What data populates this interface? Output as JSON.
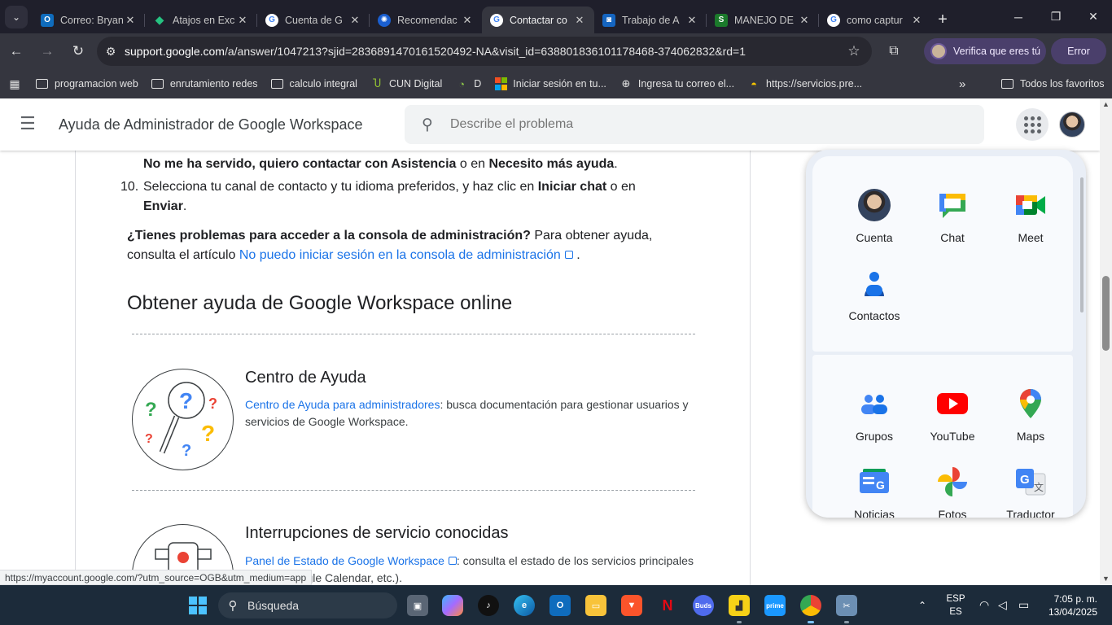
{
  "browser": {
    "tabs": [
      {
        "title": "Correo: Bryan",
        "fav": "O",
        "color": "#0f6cbd"
      },
      {
        "title": "Atajos en Exc",
        "fav": "◆",
        "color": "#1f1f2b"
      },
      {
        "title": "Cuenta de G",
        "fav": "G",
        "color": "#ffffff"
      },
      {
        "title": "Recomendac",
        "fav": "✺",
        "color": "#1a5fd0"
      },
      {
        "title": "Contactar co",
        "fav": "G",
        "color": "#ffffff"
      },
      {
        "title": "Trabajo de A",
        "fav": "◙",
        "color": "#1565c0"
      },
      {
        "title": "MANEJO DE",
        "fav": "S",
        "color": "#1b7a2b"
      },
      {
        "title": "como captur",
        "fav": "G",
        "color": "#ffffff"
      }
    ],
    "url_host": "support.google.com",
    "url_rest": "/a/answer/1047213?sjid=2836891470161520492-NA&visit_id=638801836101178468-374062832&rd=1",
    "verify_label": "Verifica que eres tú",
    "error_label": "Error",
    "bookmarks": [
      {
        "label": "programacion web",
        "type": "folder"
      },
      {
        "label": "enrutamiento redes",
        "type": "folder"
      },
      {
        "label": "calculo integral",
        "type": "folder"
      },
      {
        "label": "CUN Digital",
        "type": "icon",
        "icon": "cun-icon"
      },
      {
        "label": "D",
        "type": "icon",
        "icon": "d-icon"
      },
      {
        "label": "Iniciar sesión en tu...",
        "type": "icon",
        "icon": "microsoft-icon"
      },
      {
        "label": "Ingresa tu correo el...",
        "type": "icon",
        "icon": "globe-icon"
      },
      {
        "label": "https://servicios.pre...",
        "type": "icon",
        "icon": "helmet-icon"
      }
    ],
    "all_bookmarks": "Todos los favoritos"
  },
  "header": {
    "site_title": "Ayuda de Administrador de Google Workspace",
    "search_placeholder": "Describe el problema"
  },
  "article": {
    "line1_b1": "No me ha servido, quiero contactar con Asistencia",
    "line1_mid": " o en ",
    "line1_b2": "Necesito más ayuda",
    "line1_end": ".",
    "step_num": "10.",
    "step_text": "Selecciona tu canal de contacto y tu idioma preferidos, y haz clic en ",
    "step_b1": "Iniciar chat",
    "step_mid": " o en",
    "step_b2": "Enviar",
    "step_end": ".",
    "trouble_b": "¿Tienes problemas para acceder a la consola de administración?",
    "trouble_text": " Para obtener ayuda,",
    "trouble_text2": "consulta el artículo ",
    "trouble_link": "No puedo iniciar sesión en la consola de administración",
    "trouble_end": ".",
    "h2": "Obtener ayuda de Google Workspace online",
    "card1_title": "Centro de Ayuda",
    "card1_link": "Centro de Ayuda para administradores",
    "card1_text": ": busca documentación para gestionar usuarios y servicios de Google Workspace.",
    "card2_title": "Interrupciones de servicio conocidas",
    "card2_link": "Panel de Estado de Google Workspace",
    "card2_text": ": consulta el estado de los servicios principales (Gmail, Google Calendar, etc.)."
  },
  "status_url": "https://myaccount.google.com/?utm_source=OGB&utm_medium=app",
  "apps": {
    "row1": [
      {
        "label": "Cuenta",
        "icon": "account-avatar-icon"
      },
      {
        "label": "Chat",
        "icon": "chat-icon"
      },
      {
        "label": "Meet",
        "icon": "meet-icon"
      }
    ],
    "row2": [
      {
        "label": "Contactos",
        "icon": "contacts-icon"
      }
    ],
    "row3": [
      {
        "label": "Grupos",
        "icon": "groups-icon"
      },
      {
        "label": "YouTube",
        "icon": "youtube-icon"
      },
      {
        "label": "Maps",
        "icon": "maps-icon"
      }
    ],
    "row4": [
      {
        "label": "Noticias",
        "icon": "news-icon"
      },
      {
        "label": "Fotos",
        "icon": "photos-icon"
      },
      {
        "label": "Traductor",
        "icon": "translate-icon"
      }
    ]
  },
  "taskbar": {
    "search_label": "Búsqueda",
    "lang_top": "ESP",
    "lang_bottom": "ES",
    "time": "7:05 p. m.",
    "date": "13/04/2025"
  }
}
